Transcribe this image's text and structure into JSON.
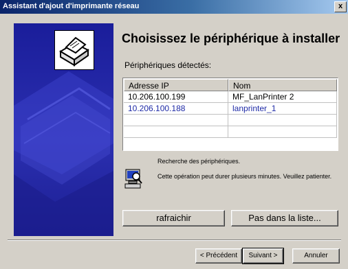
{
  "window": {
    "title": "Assistant d'ajout d'imprimante réseau",
    "close_label": "x"
  },
  "main": {
    "heading": "Choisissez le périphérique à installer",
    "subheading": "Périphériques détectés:",
    "table": {
      "columns": [
        "Adresse IP",
        "Nom"
      ],
      "rows": [
        {
          "ip": "10.206.100.199",
          "name": "MF_LanPrinter 2"
        },
        {
          "ip": "10.206.100.188",
          "name": "lanprinter_1"
        },
        {
          "ip": "",
          "name": ""
        },
        {
          "ip": "",
          "name": ""
        }
      ],
      "selected_row_index": 1
    },
    "status": {
      "title": "Recherche des périphériques.",
      "message": "Cette opération peut durer plusieurs minutes. Veuillez patienter."
    },
    "buttons": {
      "refresh": "rafraichir",
      "not_in_list": "Pas dans la liste..."
    }
  },
  "footer": {
    "previous": "< Précédent",
    "next": "Suivant >",
    "cancel": "Annuler"
  },
  "colors": {
    "title_bar": "#0a246a",
    "panel": "#2b2fb0",
    "selected_text": "#1d29a6",
    "dialog_bg": "#d4d0c8"
  }
}
